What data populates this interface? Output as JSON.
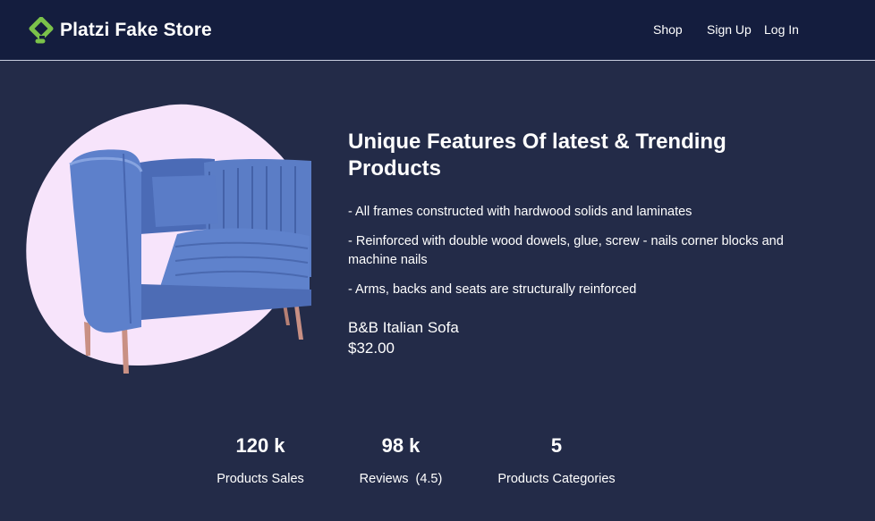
{
  "header": {
    "brand_name": "Platzi Fake Store",
    "logo_icon": "store-logo-icon",
    "nav": {
      "shop": "Shop",
      "sign_up": "Sign Up",
      "log_in": "Log In"
    }
  },
  "hero": {
    "title": "Unique Features Of latest & Trending Products",
    "features": [
      "- All frames constructed with hardwood solids and laminates",
      "- Reinforced with double wood dowels, glue, screw - nails corner blocks and machine nails",
      "- Arms, backs and seats are structurally reinforced"
    ],
    "product_name": "B&B Italian Sofa",
    "product_price": "$32.00"
  },
  "stats": [
    {
      "value": "120 k",
      "label": "Products Sales"
    },
    {
      "value": "98 k",
      "label": "Reviews  (4.5)"
    },
    {
      "value": "5",
      "label": "Products Categories"
    }
  ],
  "colors": {
    "page_background": "#232b48",
    "navbar_background": "#141d3e",
    "logo_green": "#7bc24a",
    "blob_pink": "#f7e4fb",
    "sofa_blue": "#5477c3"
  }
}
